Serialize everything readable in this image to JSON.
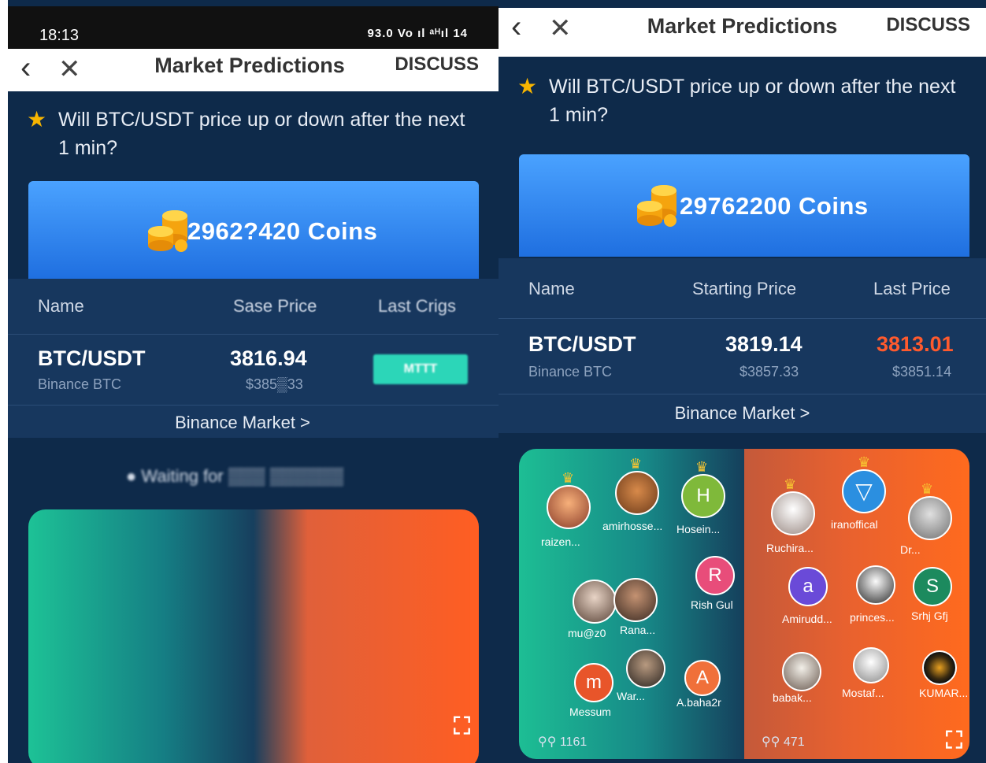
{
  "status": {
    "time": "18:13",
    "icons": "93.0 Vo ıl ᵃᴴıl 14"
  },
  "header": {
    "title": "Market Predictions",
    "discuss": "DISCUSS"
  },
  "question": "Will BTC/USDT price up or down after the next 1 min?",
  "left": {
    "coins": "2962?420 Coins",
    "table": {
      "headers": [
        "Name",
        "Sase Price",
        "Last Crigs"
      ],
      "pair": "BTC/USDT",
      "exchange": "Binance BTC",
      "start_price": "3816.94",
      "start_usd": "$385▒33",
      "last_price": "MTTT"
    },
    "market_link": "Binance Market >",
    "waiting": "● Waiting for ▒▒▒ ▒▒▒▒▒▒"
  },
  "right": {
    "coins": "29762200 Coins",
    "table": {
      "headers": [
        "Name",
        "Starting Price",
        "Last Price"
      ],
      "pair": "BTC/USDT",
      "exchange": "Binance BTC",
      "start_price": "3819.14",
      "start_usd": "$3857.33",
      "last_price": "3813.01",
      "last_usd": "$3851.14"
    },
    "market_link": "Binance Market >",
    "up_users": [
      {
        "name": "raizen...",
        "initial": ""
      },
      {
        "name": "amirhosse...",
        "initial": ""
      },
      {
        "name": "Hosein...",
        "initial": "H"
      },
      {
        "name": "Rish Gul",
        "initial": "R"
      },
      {
        "name": "mu@z0",
        "initial": ""
      },
      {
        "name": "Rana...",
        "initial": ""
      },
      {
        "name": "Messum",
        "initial": "m"
      },
      {
        "name": "War...",
        "initial": ""
      },
      {
        "name": "A.baha2r",
        "initial": "A"
      }
    ],
    "down_users": [
      {
        "name": "Ruchira...",
        "initial": ""
      },
      {
        "name": "iranoffical",
        "initial": ""
      },
      {
        "name": "Dr...",
        "initial": ""
      },
      {
        "name": "Amirudd...",
        "initial": "a"
      },
      {
        "name": "princes...",
        "initial": ""
      },
      {
        "name": "Srhj Gfj",
        "initial": "S"
      },
      {
        "name": "babak...",
        "initial": ""
      },
      {
        "name": "Mostaf...",
        "initial": ""
      },
      {
        "name": "KUMAR...",
        "initial": ""
      }
    ],
    "up_count": "1161",
    "down_count": "471"
  },
  "colors": {
    "accent_blue": "#2f86f2",
    "down_orange": "#ff5a2d",
    "up_teal": "#1dc296",
    "bg_navy": "#0e2a4a",
    "crown": "#f7c531"
  }
}
